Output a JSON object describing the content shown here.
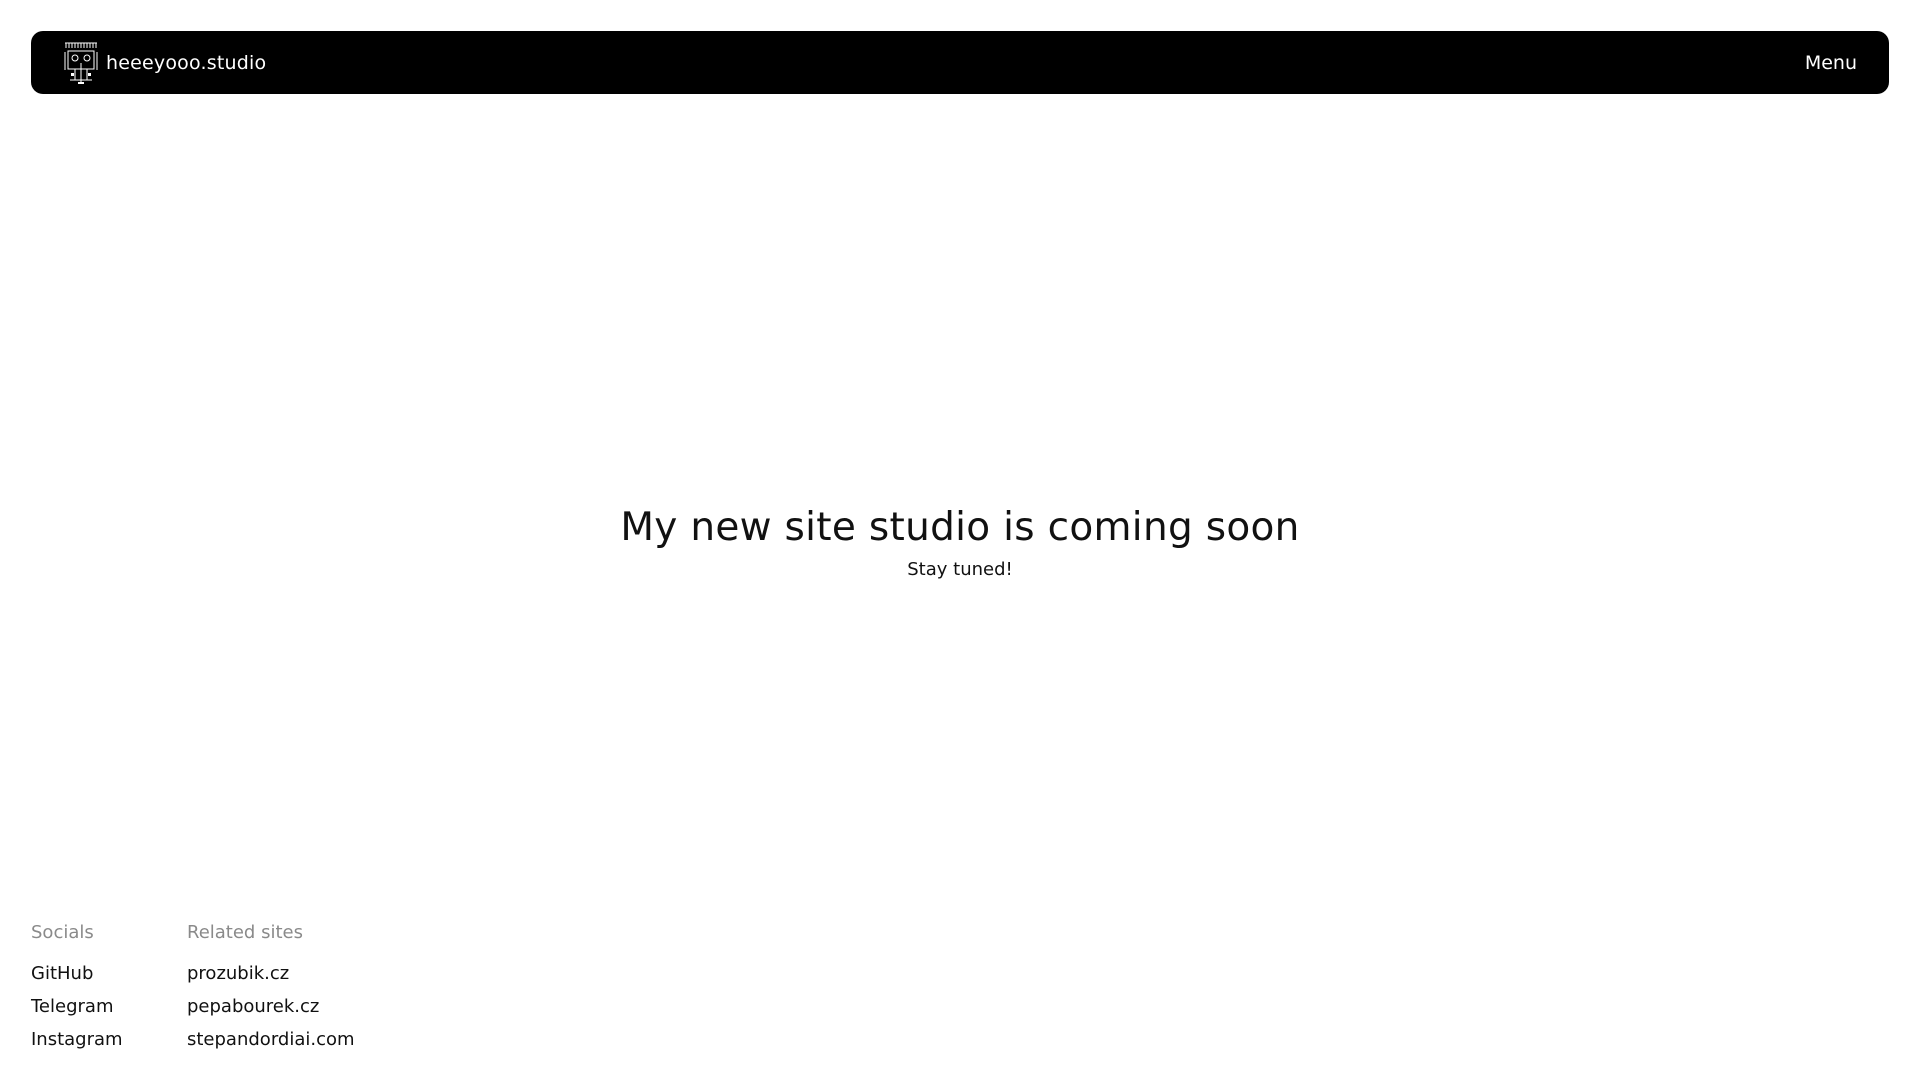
{
  "navbar": {
    "brand_name": "heeeyooo.studio",
    "logo_icon": "studio-logo-icon",
    "menu_label": "Menu",
    "background_color": "#000000",
    "text_color": "#ffffff"
  },
  "hero": {
    "heading": "My new site studio is coming soon",
    "subheading": "Stay tuned!"
  },
  "footer": {
    "socials": {
      "heading": "Socials",
      "links": [
        "GitHub",
        "Telegram",
        "Instagram"
      ]
    },
    "related": {
      "heading": "Related sites",
      "links": [
        "prozubik.cz",
        "pepabourek.cz",
        "stepandordiai.com"
      ]
    },
    "heading_color": "#8a8a8a"
  }
}
